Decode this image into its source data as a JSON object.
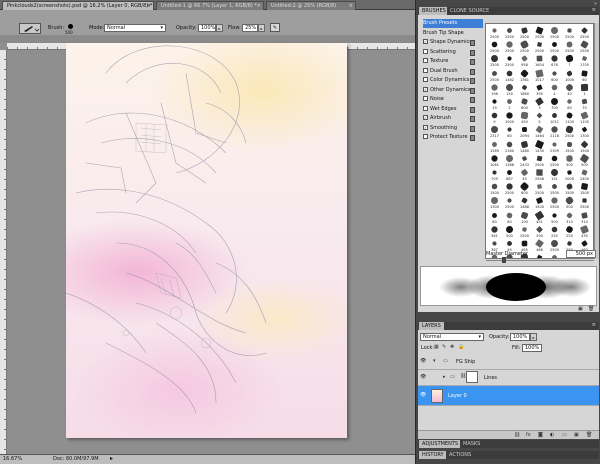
{
  "tabs": [
    {
      "label": "Pinkclouds2(screenshots).psd @ 16.2% (Layer 0, RGB/8) *",
      "active": true
    },
    {
      "label": "Untitled-1 @ 66.7% (Layer 1, RGB/8) *",
      "active": false
    },
    {
      "label": "Untitled-2 @ 25% (RGB/8)",
      "active": false
    }
  ],
  "tab_close": "×",
  "options": {
    "brush_label": "Brush:",
    "brush_size": "500",
    "mode_label": "Mode:",
    "mode_value": "Normal",
    "opacity_label": "Opacity:",
    "opacity_value": "100%",
    "flow_label": "Flow:",
    "flow_value": "25%"
  },
  "status": {
    "zoom": "16.67%",
    "doc": "Doc: 80.0M/97.9M"
  },
  "brushes_panel": {
    "tabs": [
      "BRUSHES",
      "CLONE SOURCE"
    ],
    "options": [
      {
        "label": "Brush Presets",
        "checked": null,
        "selected": true
      },
      {
        "label": "Brush Tip Shape",
        "checked": null,
        "selected": false
      },
      {
        "label": "Shape Dynamics",
        "checked": true
      },
      {
        "label": "Scattering",
        "checked": false
      },
      {
        "label": "Texture",
        "checked": false
      },
      {
        "label": "Dual Brush",
        "checked": false
      },
      {
        "label": "Color Dynamics",
        "checked": false
      },
      {
        "label": "Other Dynamics",
        "checked": true
      },
      {
        "label": "Noise",
        "checked": false
      },
      {
        "label": "Wet Edges",
        "checked": false
      },
      {
        "label": "Airbrush",
        "checked": true
      },
      {
        "label": "Smoothing",
        "checked": true
      },
      {
        "label": "Protect Texture",
        "checked": false
      }
    ],
    "brush_sizes": [
      "2500",
      "2500",
      "2500",
      "2500",
      "2500",
      "2500",
      "2500",
      "2500",
      "2500",
      "2500",
      "2500",
      "2500",
      "2500",
      "2500",
      "2500",
      "2500",
      "958",
      "1604",
      "676",
      "7",
      "1700",
      "2500",
      "1482",
      "1361",
      "1017",
      "600",
      "1000",
      "60",
      "196",
      "150",
      "1860",
      "395",
      "4",
      "40",
      "1",
      "19",
      "2",
      "600",
      "3",
      "700",
      "60",
      "70",
      "9",
      "1000",
      "450",
      "5",
      "1011",
      "1105",
      "1105",
      "2317",
      "80",
      "2094",
      "1464",
      "2118",
      "2500",
      "1300",
      "1269",
      "2160",
      "1480",
      "1430",
      "2309",
      "1500",
      "1500",
      "1061",
      "1388",
      "2433",
      "2500",
      "2500",
      "500",
      "500",
      "709",
      "867",
      "45",
      "2506",
      "151",
      "2000",
      "2400",
      "1500",
      "2500",
      "600",
      "2500",
      "2500",
      "1500",
      "1500",
      "1300",
      "2500",
      "1488",
      "1500",
      "2500",
      "500",
      "2500",
      "80",
      "80",
      "100",
      "451",
      "500",
      "310",
      "310",
      "361",
      "500",
      "2500",
      "290",
      "250",
      "250",
      "435",
      "367",
      "49",
      "465",
      "466",
      "2500",
      "250",
      "463",
      "94",
      "61",
      "150",
      "80",
      "90",
      "90",
      "90"
    ],
    "master_diameter_label": "Master Diameter",
    "master_diameter_value": "500 px"
  },
  "layers_panel": {
    "tab": "LAYERS",
    "blend_mode": "Normal",
    "opacity_label": "Opacity:",
    "opacity_value": "100%",
    "lock_label": "Lock:",
    "fill_label": "Fill:",
    "fill_value": "100%",
    "layers": [
      {
        "name": "FG Ship",
        "type": "group",
        "expanded": true
      },
      {
        "name": "Lines",
        "type": "group",
        "expanded": false
      },
      {
        "name": "Layer 0",
        "type": "layer",
        "selected": true
      }
    ]
  },
  "bottom_tabs": {
    "adjustments": [
      "ADJUSTMENTS",
      "MASKS"
    ],
    "history": [
      "HISTORY",
      "ACTIONS"
    ]
  },
  "colors": {
    "selection_blue": "#3b95f0",
    "panel_bg": "#d6d6d6"
  }
}
